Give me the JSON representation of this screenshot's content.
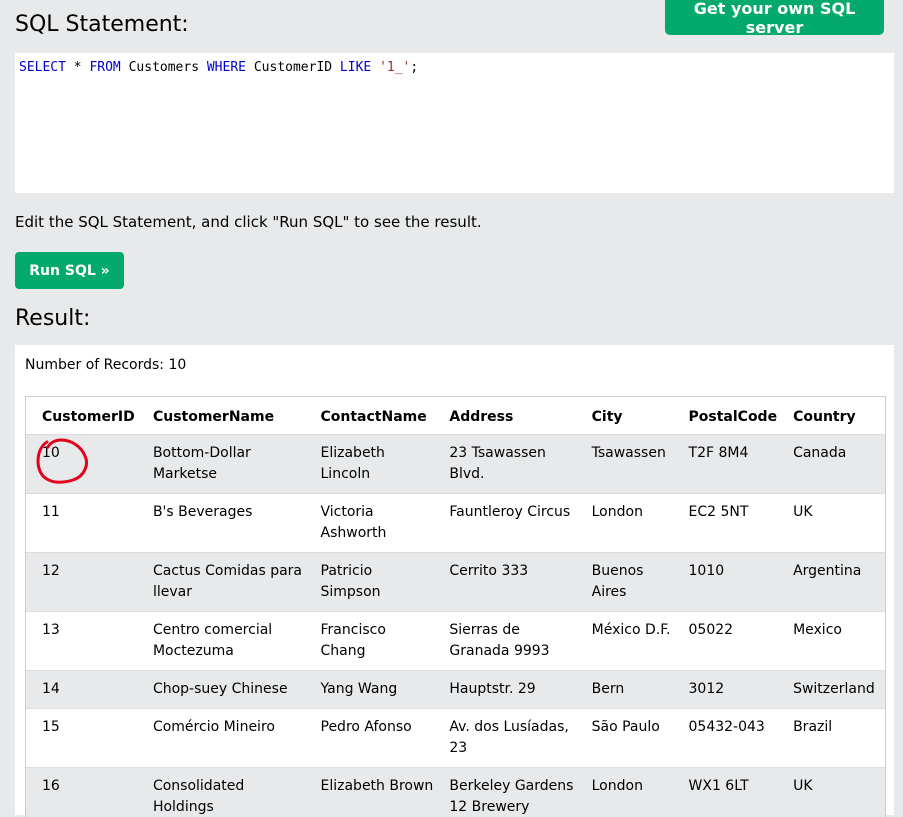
{
  "header": {
    "title": "SQL Statement:",
    "server_button": "Get your own SQL server"
  },
  "editor": {
    "tokens": [
      {
        "text": "SELECT",
        "type": "kw"
      },
      {
        "text": " * ",
        "type": "plain"
      },
      {
        "text": "FROM",
        "type": "kw"
      },
      {
        "text": " Customers ",
        "type": "plain"
      },
      {
        "text": "WHERE",
        "type": "kw"
      },
      {
        "text": " CustomerID ",
        "type": "plain"
      },
      {
        "text": "LIKE",
        "type": "kw"
      },
      {
        "text": " ",
        "type": "plain"
      },
      {
        "text": "'1_'",
        "type": "str"
      },
      {
        "text": ";",
        "type": "plain"
      }
    ]
  },
  "instructions": "Edit the SQL Statement, and click \"Run SQL\" to see the result.",
  "run_button": "Run SQL »",
  "result": {
    "title": "Result:",
    "records": "Number of Records: 10",
    "columns": [
      "CustomerID",
      "CustomerName",
      "ContactName",
      "Address",
      "City",
      "PostalCode",
      "Country"
    ],
    "rows": [
      [
        "10",
        "Bottom-Dollar Marketse",
        "Elizabeth Lincoln",
        "23 Tsawassen Blvd.",
        "Tsawassen",
        "T2F 8M4",
        "Canada"
      ],
      [
        "11",
        "B's Beverages",
        "Victoria Ashworth",
        "Fauntleroy Circus",
        "London",
        "EC2 5NT",
        "UK"
      ],
      [
        "12",
        "Cactus Comidas para llevar",
        "Patricio Simpson",
        "Cerrito 333",
        "Buenos Aires",
        "1010",
        "Argentina"
      ],
      [
        "13",
        "Centro comercial Moctezuma",
        "Francisco Chang",
        "Sierras de Granada 9993",
        "México D.F.",
        "05022",
        "Mexico"
      ],
      [
        "14",
        "Chop-suey Chinese",
        "Yang Wang",
        "Hauptstr. 29",
        "Bern",
        "3012",
        "Switzerland"
      ],
      [
        "15",
        "Comércio Mineiro",
        "Pedro Afonso",
        "Av. dos Lusíadas, 23",
        "São Paulo",
        "05432-043",
        "Brazil"
      ],
      [
        "16",
        "Consolidated Holdings",
        "Elizabeth Brown",
        "Berkeley Gardens 12 Brewery",
        "London",
        "WX1 6LT",
        "UK"
      ]
    ]
  },
  "colors": {
    "accent": "#04aa6d",
    "background": "#e7e9eb",
    "annotation": "#e3001b"
  }
}
